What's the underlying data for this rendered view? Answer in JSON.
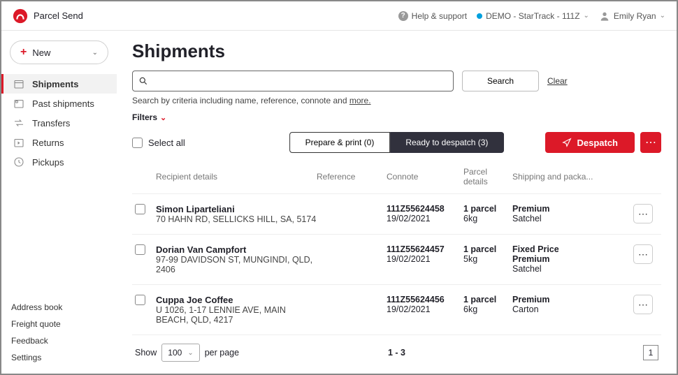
{
  "header": {
    "brand": "Parcel Send",
    "help": "Help & support",
    "account": "DEMO - StarTrack - 111Z",
    "user": "Emily Ryan"
  },
  "sidebar": {
    "new_label": "New",
    "items": [
      {
        "label": "Shipments"
      },
      {
        "label": "Past shipments"
      },
      {
        "label": "Transfers"
      },
      {
        "label": "Returns"
      },
      {
        "label": "Pickups"
      }
    ],
    "bottom": [
      "Address book",
      "Freight quote",
      "Feedback",
      "Settings"
    ]
  },
  "main": {
    "title": "Shipments",
    "search_placeholder": "",
    "search_btn": "Search",
    "clear": "Clear",
    "hint_prefix": "Search by criteria including name, reference, connote and ",
    "hint_more": "more.",
    "filters": "Filters",
    "select_all": "Select all",
    "seg_prepare": "Prepare & print (0)",
    "seg_ready": "Ready to despatch (3)",
    "despatch": "Despatch",
    "columns": {
      "recipient": "Recipient details",
      "reference": "Reference",
      "connote": "Connote",
      "parcel": "Parcel details",
      "shipping": "Shipping and packa..."
    },
    "rows": [
      {
        "name": "Simon Liparteliani",
        "addr": "70 HAHN RD, SELLICKS HILL, SA, 5174",
        "connote": "111Z55624458",
        "date": "19/02/2021",
        "parcels": "1 parcel",
        "weight": "6kg",
        "shp1": "Premium",
        "shp2": "Satchel",
        "shp3": ""
      },
      {
        "name": "Dorian Van Campfort",
        "addr": "97-99 DAVIDSON ST, MUNGINDI, QLD, 2406",
        "connote": "111Z55624457",
        "date": "19/02/2021",
        "parcels": "1 parcel",
        "weight": "5kg",
        "shp1": "Fixed Price",
        "shp2": "Premium",
        "shp3": "Satchel"
      },
      {
        "name": "Cuppa Joe Coffee",
        "addr": "U 1026, 1-17 LENNIE AVE, MAIN BEACH, QLD, 4217",
        "connote": "111Z55624456",
        "date": "19/02/2021",
        "parcels": "1 parcel",
        "weight": "6kg",
        "shp1": "Premium",
        "shp2": "Carton",
        "shp3": ""
      }
    ],
    "footer": {
      "show": "Show",
      "per": "100",
      "perpage": "per page",
      "range": "1 - 3",
      "page": "1"
    }
  }
}
